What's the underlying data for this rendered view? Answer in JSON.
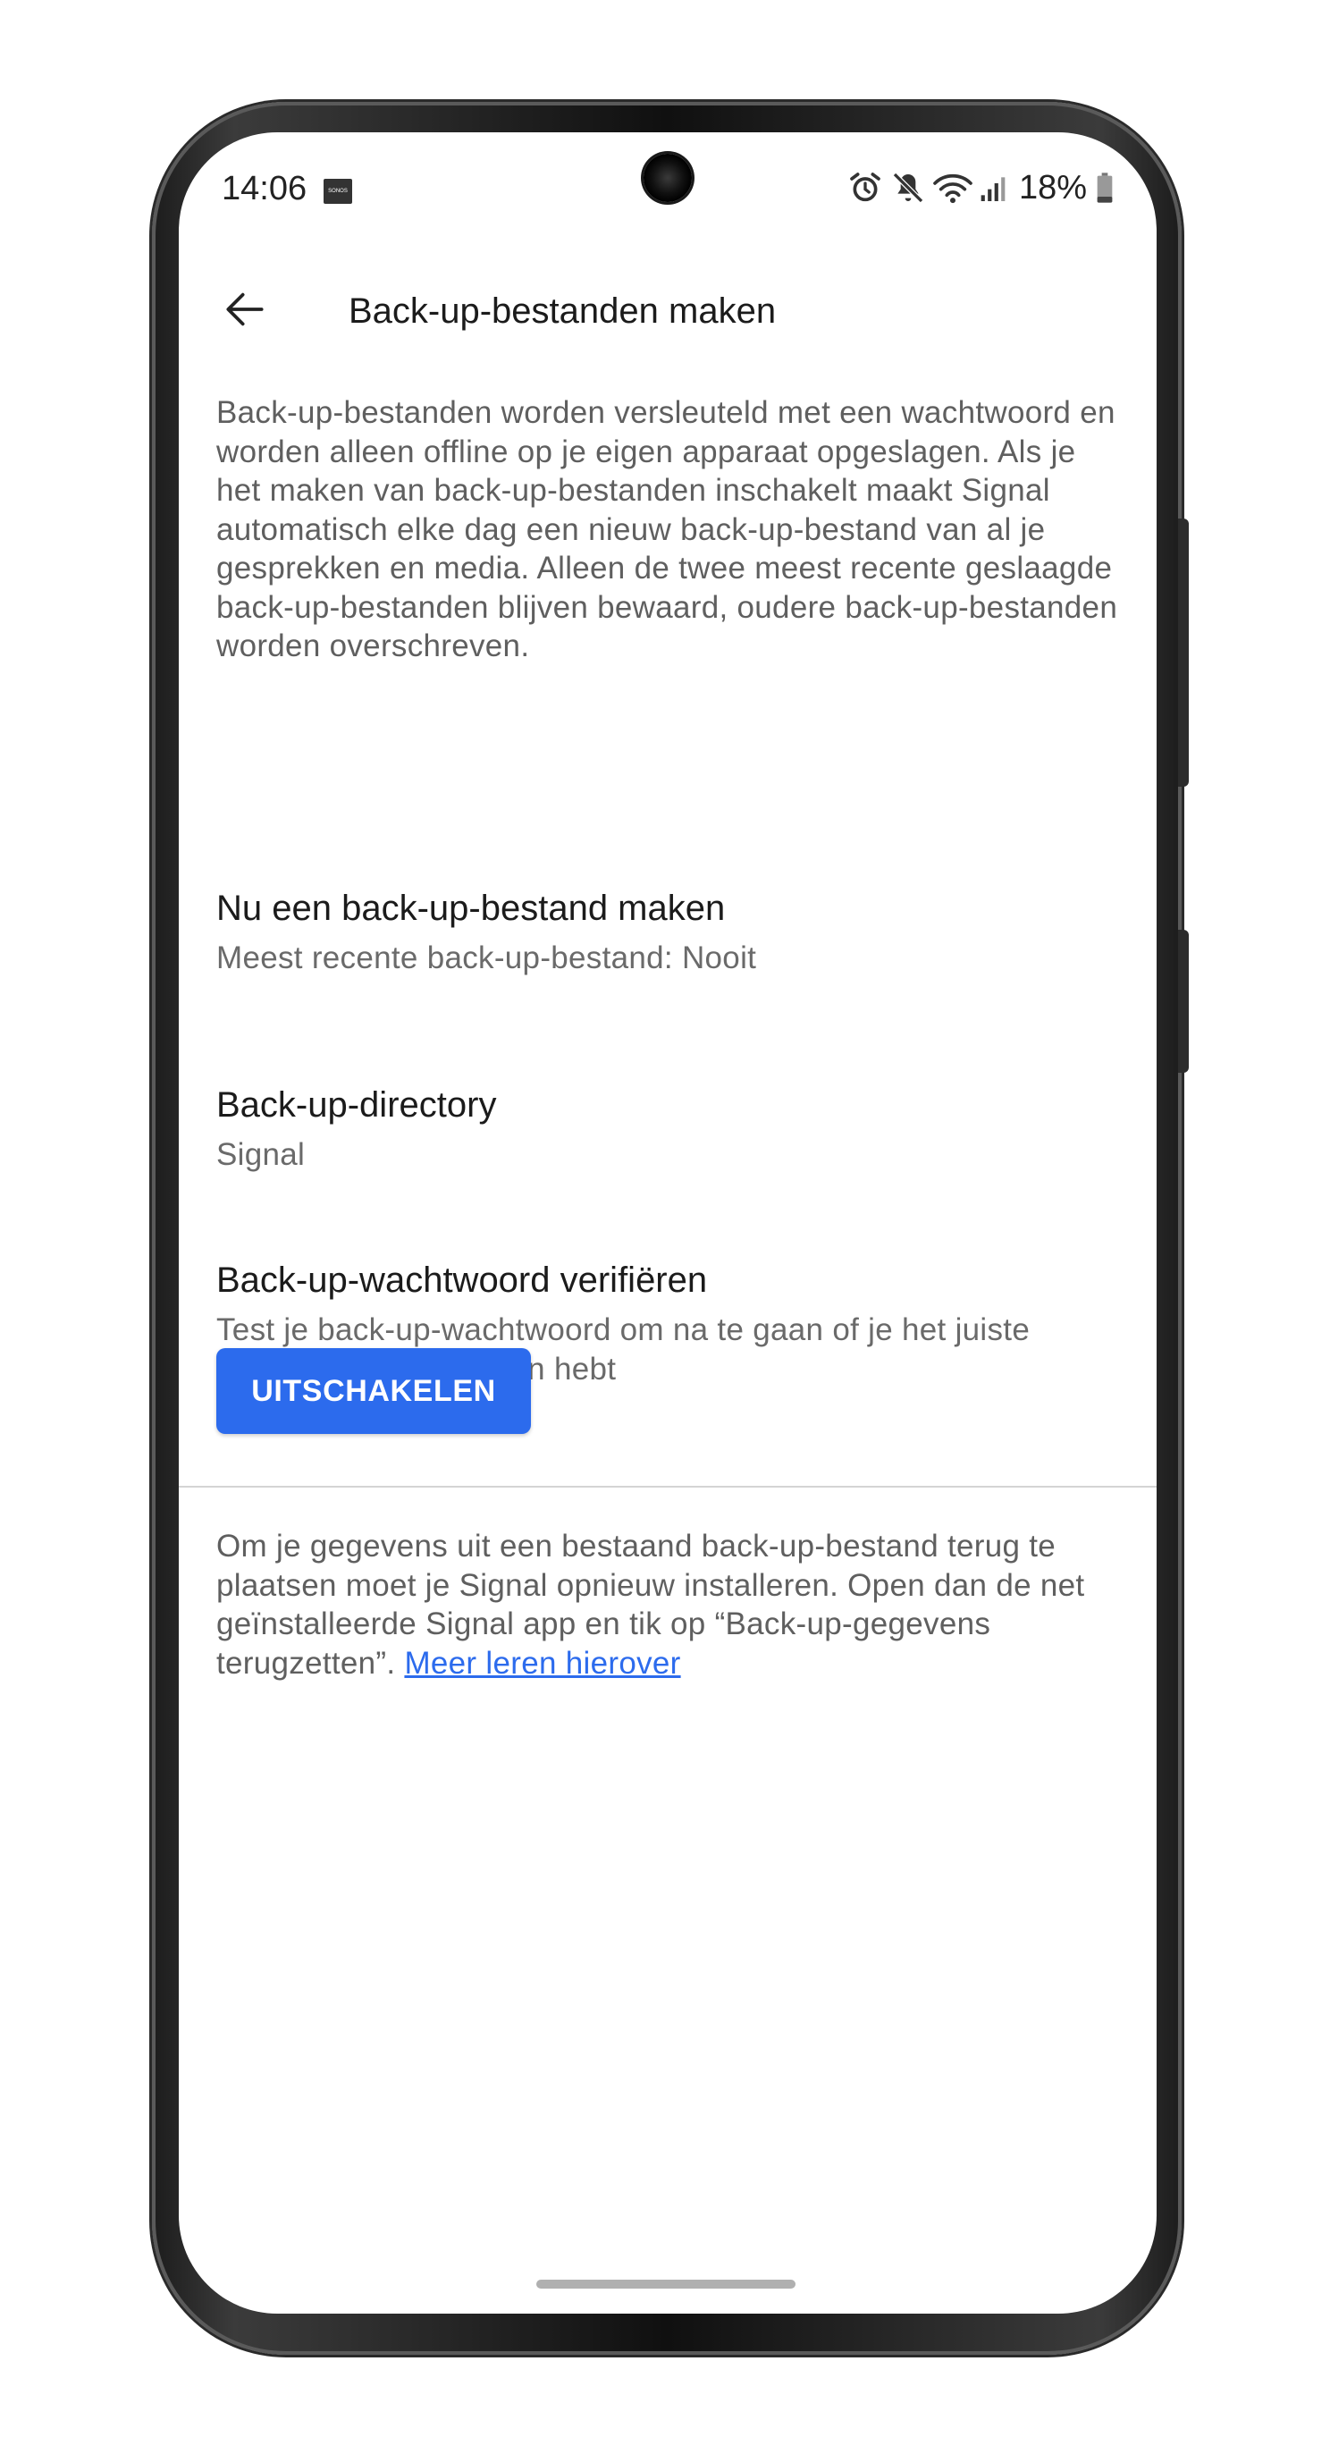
{
  "status_bar": {
    "time": "14:06",
    "notification_badge": "SONOS",
    "battery_percent": "18%",
    "icons": [
      "alarm-icon",
      "mute-icon",
      "wifi-icon",
      "signal-icon",
      "battery-icon"
    ]
  },
  "app_bar": {
    "back_icon": "arrow-left-icon",
    "title": "Back-up-bestanden maken"
  },
  "intro_text": "Back-up-bestanden worden versleuteld met een wachtwoord en worden alleen offline op je eigen apparaat opgeslagen. Als je het maken van back-up-bestanden inschakelt maakt Signal automatisch elke dag een nieuw back-up-bestand van al je gesprekken en media. Alleen de twee meest recente geslaagde back-up-bestanden blijven bewaard, oudere back-up-bestanden worden overschreven.",
  "preferences": [
    {
      "title": "Nu een back-up-bestand maken",
      "summary": "Meest recente back-up-bestand: Nooit"
    },
    {
      "title": "Back-up-directory",
      "summary": "Signal"
    },
    {
      "title": "Back-up-wachtwoord verifiëren",
      "summary": "Test je back-up-wachtwoord om na te gaan of je het juiste wachtwoord onthouden hebt"
    }
  ],
  "disable_button": "UITSCHAKELEN",
  "footer": {
    "text": "Om je gegevens uit een bestaand back-up-bestand terug te plaatsen moet je Signal opnieuw installeren. Open dan de net geïnstalleerde Signal app en tik op “Back-up-gegevens terugzetten”.",
    "link": "Meer leren hierover"
  },
  "colors": {
    "accent": "#2c6bed",
    "title_text": "#1b1b1b",
    "body_text": "#5f5f5f",
    "divider": "#d4d4d4"
  }
}
